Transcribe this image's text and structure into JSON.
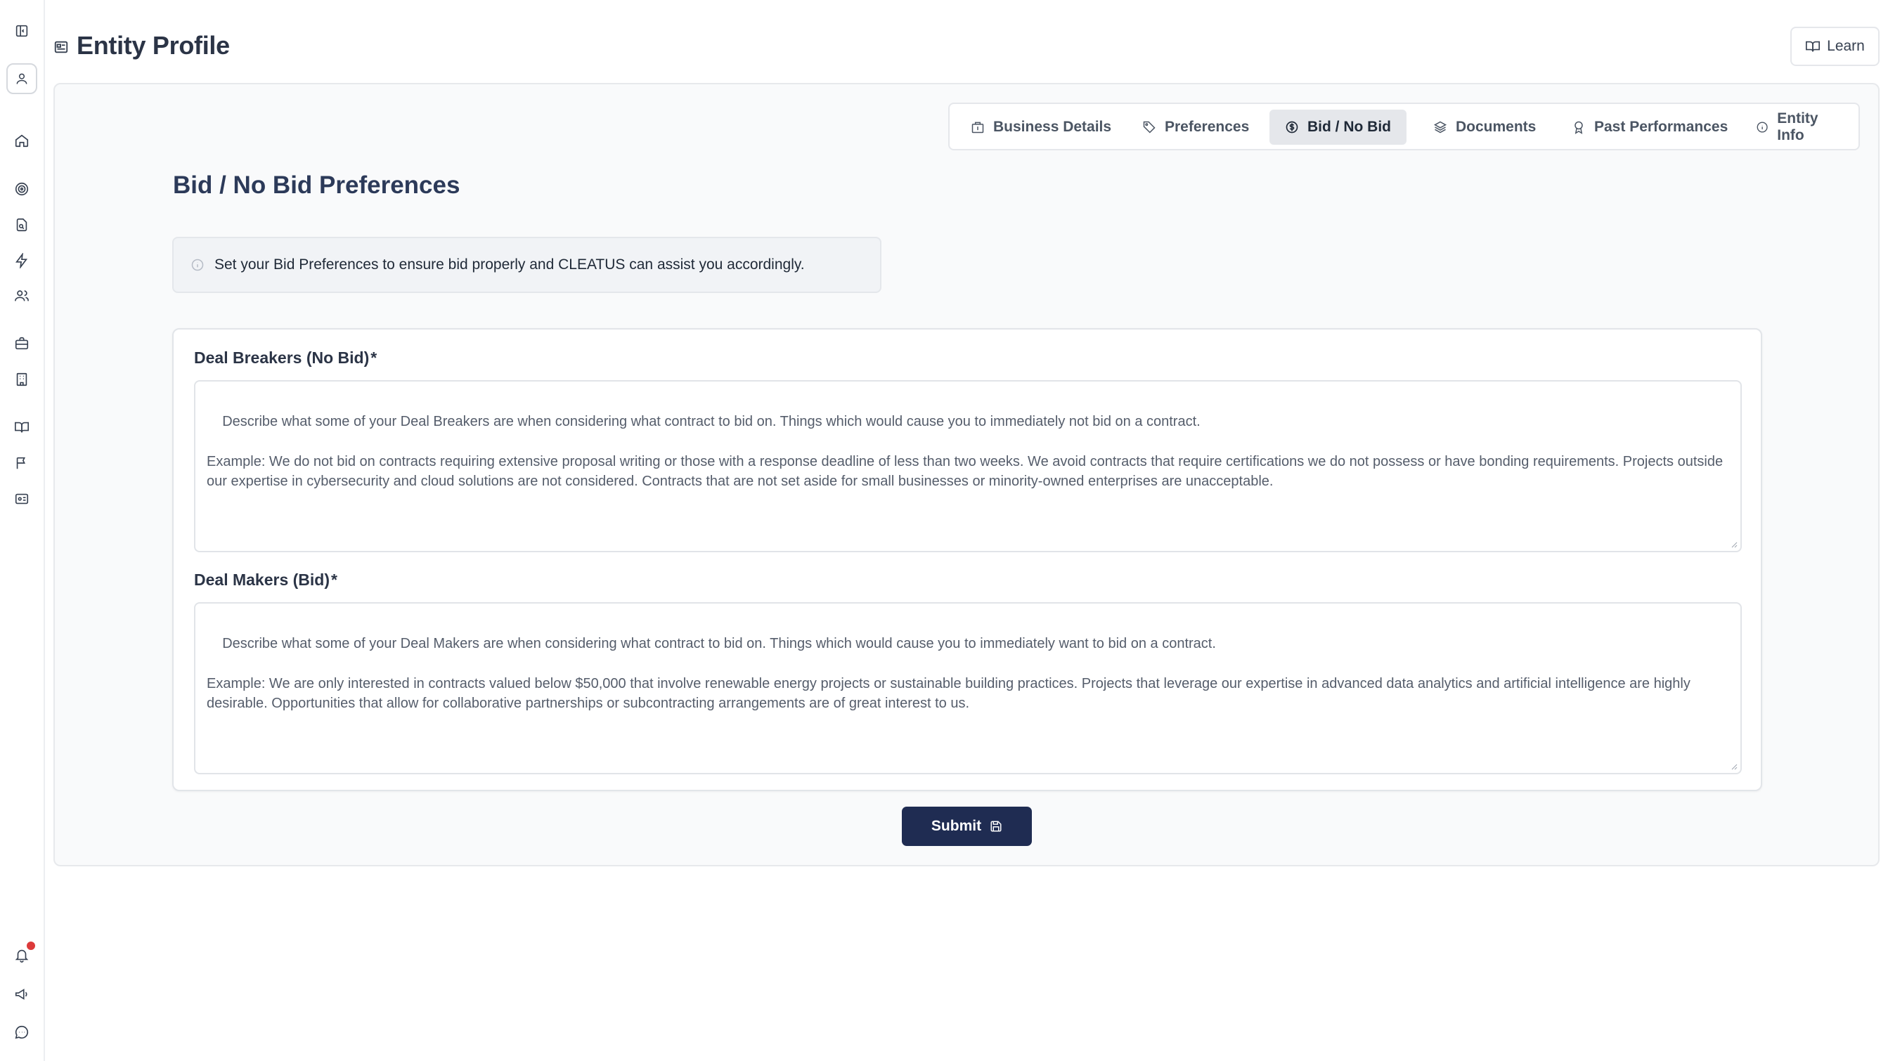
{
  "sidebar": {
    "icons": [
      {
        "name": "sidebar-toggle-icon"
      },
      {
        "name": "user-icon"
      },
      {
        "name": "home-icon"
      },
      {
        "name": "target-icon"
      },
      {
        "name": "file-search-icon"
      },
      {
        "name": "lightning-icon"
      },
      {
        "name": "users-icon"
      },
      {
        "name": "briefcase-icon"
      },
      {
        "name": "building-icon"
      },
      {
        "name": "book-icon"
      },
      {
        "name": "flag-icon"
      },
      {
        "name": "id-card-icon"
      },
      {
        "name": "bell-icon"
      },
      {
        "name": "megaphone-icon"
      },
      {
        "name": "chat-icon"
      }
    ],
    "notification_color": "#dc3a3a"
  },
  "header": {
    "title": "Entity Profile",
    "learn_label": "Learn"
  },
  "tabs": [
    {
      "label": "Business Details",
      "icon": "building-icon",
      "active": false
    },
    {
      "label": "Preferences",
      "icon": "tag-icon",
      "active": false
    },
    {
      "label": "Bid / No Bid",
      "icon": "dollar-circle-icon",
      "active": true
    },
    {
      "label": "Documents",
      "icon": "layers-icon",
      "active": false
    },
    {
      "label": "Past Performances",
      "icon": "award-icon",
      "active": false
    },
    {
      "label": "Entity Info",
      "icon": "info-icon",
      "active": false
    }
  ],
  "main": {
    "section_title": "Bid / No Bid Preferences",
    "info_text": "Set your Bid Preferences to ensure bid properly and CLEATUS can assist you accordingly."
  },
  "form": {
    "deal_breakers": {
      "label": "Deal Breakers (No Bid)",
      "required_mark": "*",
      "placeholder": "Describe what some of your Deal Breakers are when considering what contract to bid on. Things which would cause you to immediately not bid on a contract.\n\nExample: We do not bid on contracts requiring extensive proposal writing or those with a response deadline of less than two weeks. We avoid contracts that require certifications we do not possess or have bonding requirements. Projects outside our expertise in cybersecurity and cloud solutions are not considered. Contracts that are not set aside for small businesses or minority-owned enterprises are unacceptable."
    },
    "deal_makers": {
      "label": "Deal Makers (Bid)",
      "required_mark": "*",
      "placeholder": "Describe what some of your Deal Makers are when considering what contract to bid on. Things which would cause you to immediately want to bid on a contract.\n\nExample: We are only interested in contracts valued below $50,000 that involve renewable energy projects or sustainable building practices. Projects that leverage our expertise in advanced data analytics and artificial intelligence are highly desirable. Opportunities that allow for collaborative partnerships or subcontracting arrangements are of great interest to us."
    },
    "submit_label": "Submit"
  },
  "colors": {
    "primary": "#1f2c52",
    "title": "#2c3a59",
    "panel_bg": "#f9fafb"
  }
}
